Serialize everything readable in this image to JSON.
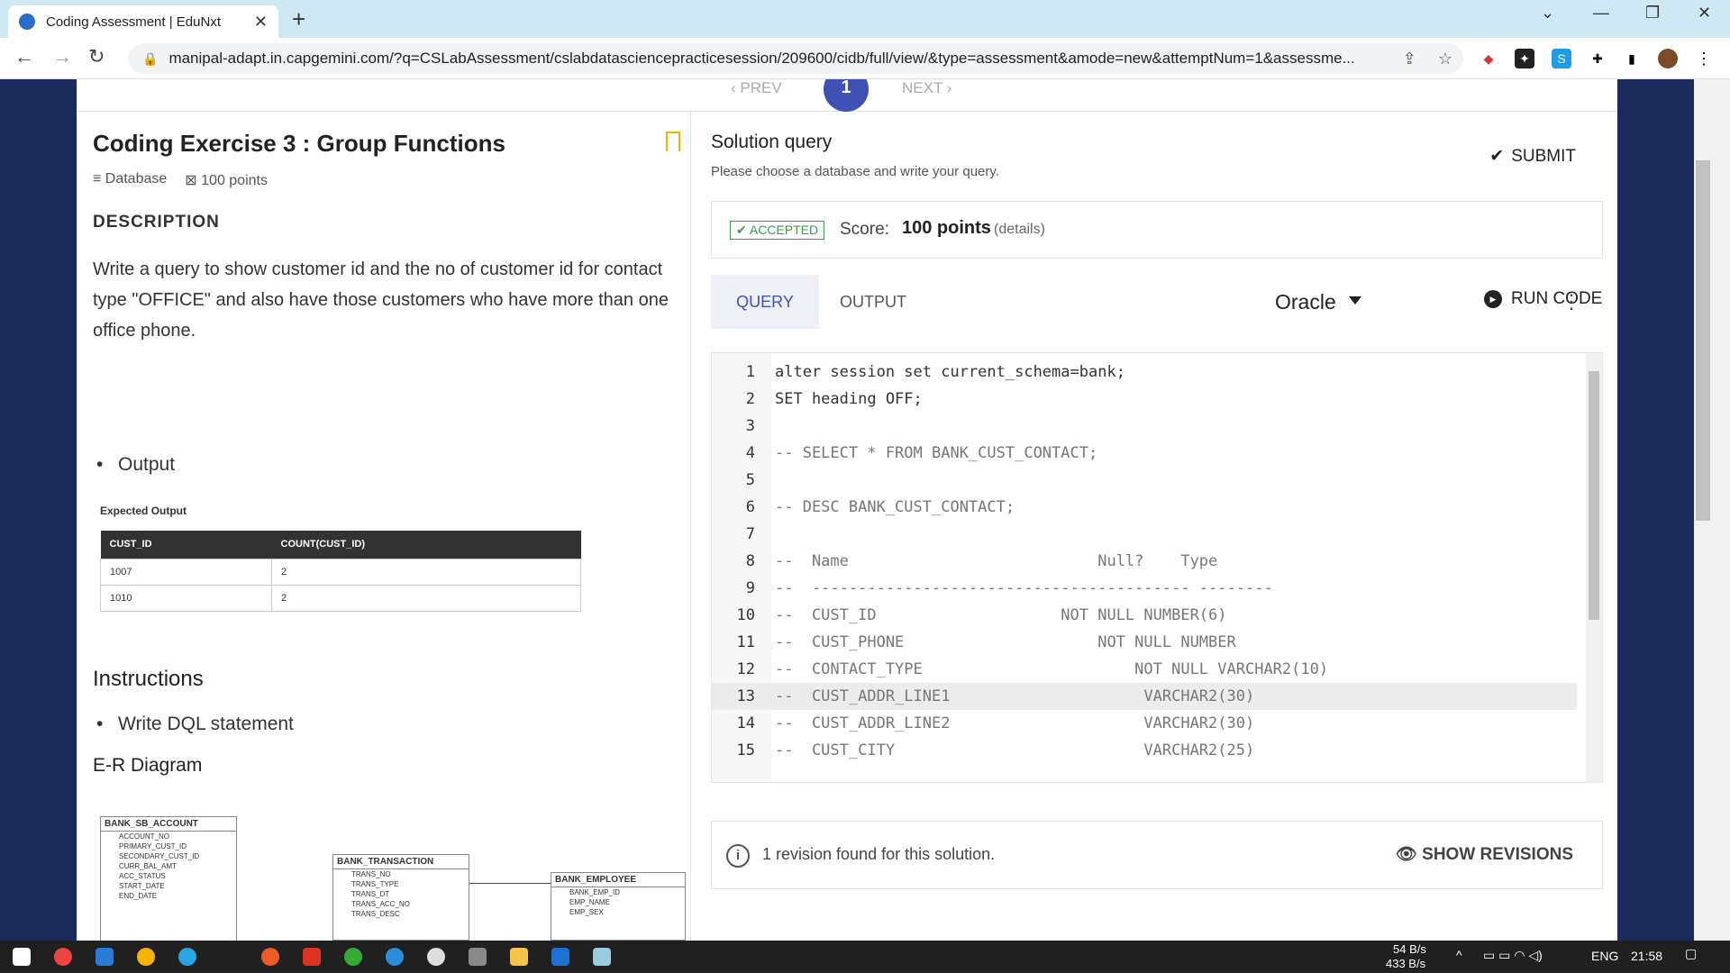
{
  "browser": {
    "tab_title": "Coding Assessment | EduNxt",
    "url": "manipal-adapt.in.capgemini.com/?q=CSLabAssessment/cslabdatasciencepracticesession/209600/cidb/full/view/&type=assessment&amode=new&attemptNum=1&assessme..."
  },
  "pager": {
    "prev": "‹ PREV",
    "current": "1",
    "next": "NEXT ›"
  },
  "exercise": {
    "title": "Coding Exercise 3 : Group Functions",
    "category": "Database",
    "points": "100 points",
    "description_heading": "DESCRIPTION",
    "description": "Write a query to show customer id and the no of customer id for contact type \"OFFICE\" and also have those customers who have more than one office phone.",
    "output_bullet": "Output",
    "expected_label": "Expected Output",
    "expected_columns": [
      "CUST_ID",
      "COUNT(CUST_ID)"
    ],
    "expected_rows": [
      [
        "1007",
        "2"
      ],
      [
        "1010",
        "2"
      ]
    ],
    "instructions_heading": "Instructions",
    "instruction_bullet": "Write DQL statement",
    "er_heading": "E-R Diagram",
    "er_tables": [
      {
        "name": "BANK_SB_ACCOUNT",
        "fields": [
          "ACCOUNT_NO",
          "PRIMARY_CUST_ID",
          "SECONDARY_CUST_ID",
          "CURR_BAL_AMT",
          "ACC_STATUS",
          "START_DATE",
          "END_DATE"
        ]
      },
      {
        "name": "BANK_TRANSACTION",
        "fields": [
          "TRANS_NO",
          "TRANS_TYPE",
          "TRANS_DT",
          "TRANS_ACC_NO",
          "TRANS_DESC"
        ]
      },
      {
        "name": "BANK_EMPLOYEE",
        "fields": [
          "BANK_EMP_ID",
          "EMP_NAME",
          "EMP_SEX"
        ]
      }
    ]
  },
  "solution": {
    "heading": "Solution query",
    "subtitle": "Please choose a database and write your query.",
    "submit": "SUBMIT",
    "status": "ACCEPTED",
    "score_label": "Score:",
    "score_value": "100 points",
    "score_details": "(details)",
    "tab_query": "QUERY",
    "tab_output": "OUTPUT",
    "language": "Oracle",
    "run": "RUN CODE",
    "code_lines": [
      "alter session set current_schema=bank;",
      "SET heading OFF;",
      "",
      "-- SELECT * FROM BANK_CUST_CONTACT;",
      "",
      "-- DESC BANK_CUST_CONTACT;",
      "",
      "--  Name                           Null?    Type",
      "--  ----------------------------------------- --------",
      "--  CUST_ID                    NOT NULL NUMBER(6)",
      "--  CUST_PHONE                     NOT NULL NUMBER",
      "--  CONTACT_TYPE                       NOT NULL VARCHAR2(10)",
      "--  CUST_ADDR_LINE1                     VARCHAR2(30)",
      "--  CUST_ADDR_LINE2                     VARCHAR2(30)",
      "--  CUST_CITY                           VARCHAR2(25)"
    ],
    "highlighted_line": 13,
    "revisions_text": "1 revision found for this solution.",
    "show_revisions": "SHOW REVISIONS"
  },
  "taskbar": {
    "net_up": "54 B/s",
    "net_down": "433 B/s",
    "lang": "ENG",
    "time": "21:58"
  }
}
